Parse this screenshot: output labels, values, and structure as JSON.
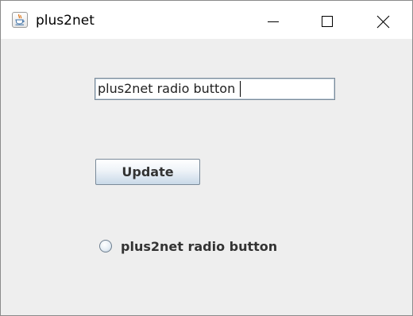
{
  "window": {
    "title": "plus2net",
    "icon": "java-icon",
    "controls": [
      "minimize-icon",
      "maximize-icon",
      "close-icon"
    ]
  },
  "form": {
    "text_field_value": "plus2net radio button",
    "update_label": "Update",
    "radio_label": "plus2net radio button",
    "radio_selected": false
  },
  "colors": {
    "content_background": "#eeeeee",
    "titlebar_background": "#ffffff",
    "button_gradient_bottom": "#c9d9e8",
    "border": "#7a8a99"
  }
}
